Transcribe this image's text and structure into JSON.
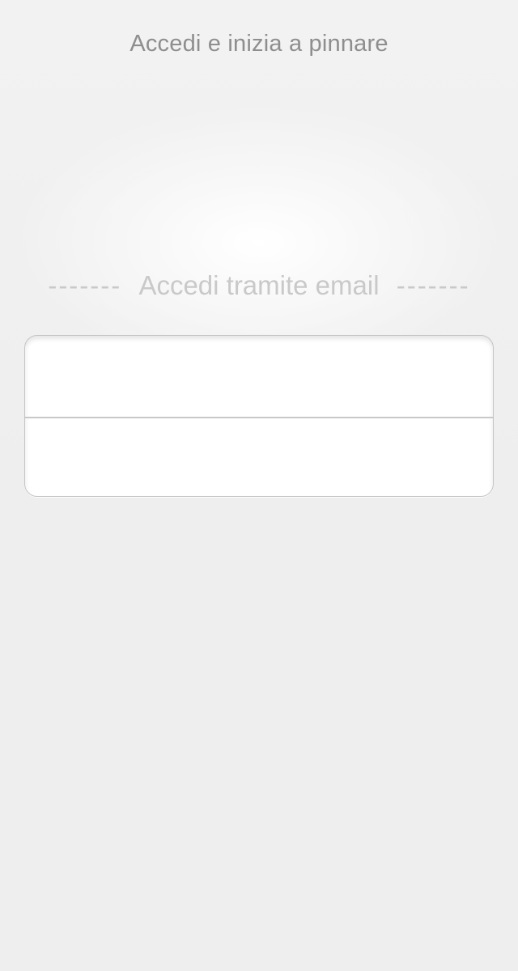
{
  "header": {
    "title": "Accedi e inizia a pinnare"
  },
  "email_section": {
    "dashes_left": "-------",
    "label": "Accedi tramite email",
    "dashes_right": "-------"
  },
  "login_form": {
    "email_value": "",
    "email_placeholder": "",
    "password_value": "",
    "password_placeholder": ""
  },
  "colors": {
    "background": "#eeeeee",
    "title_text": "#8e8e8e",
    "separator_text": "#c9c9c9",
    "form_border": "#c4c4c4"
  }
}
